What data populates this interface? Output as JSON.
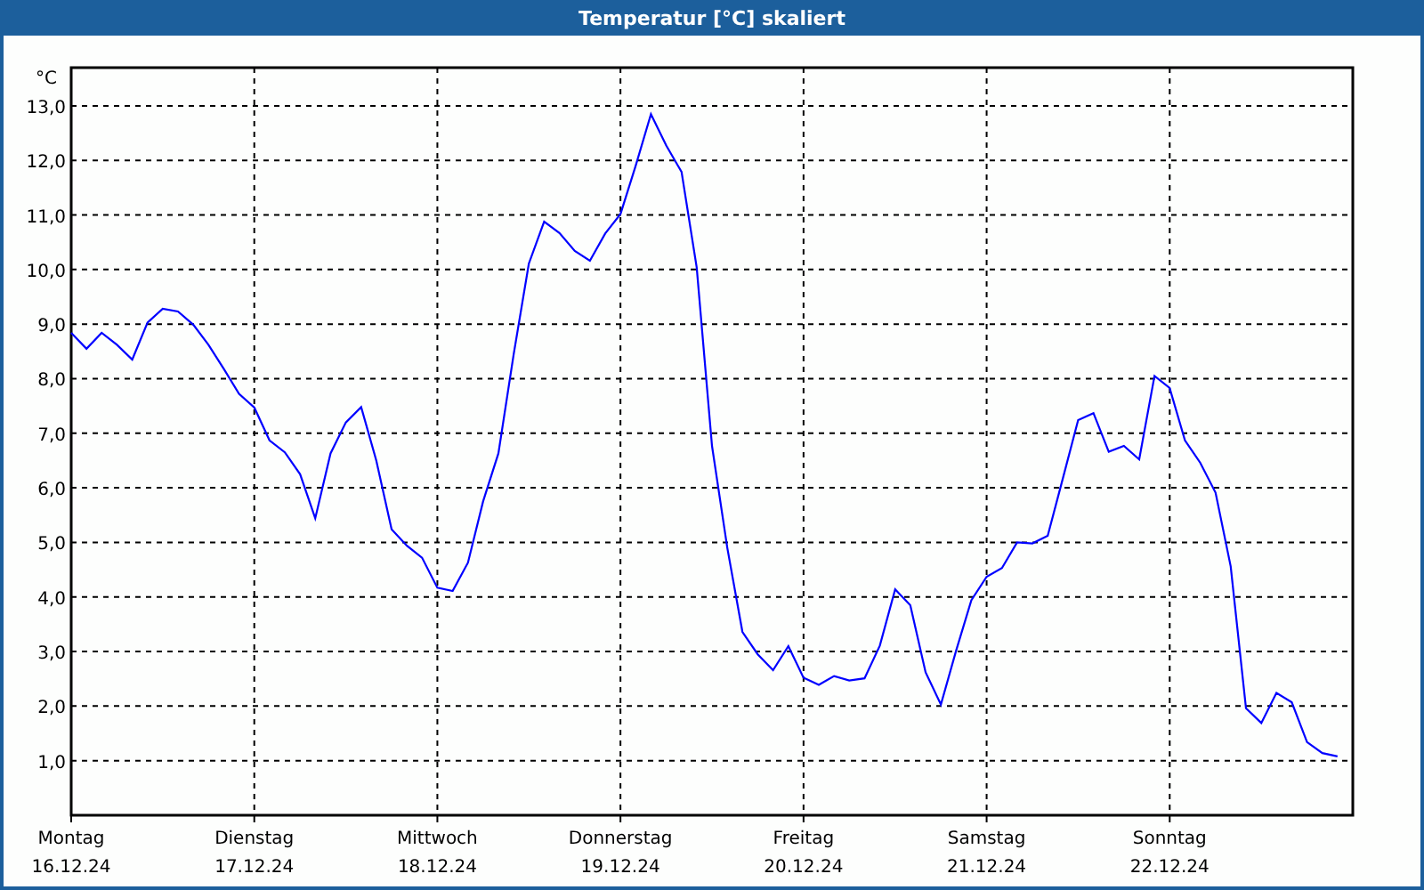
{
  "window": {
    "title": "Temperatur [°C] skaliert"
  },
  "chart": {
    "chart_data": {
      "type": "line",
      "ylabel": "°C",
      "grid": true,
      "ylim": [
        0,
        13.7
      ],
      "yticks": [
        {
          "value": 1,
          "label": "1,0"
        },
        {
          "value": 2,
          "label": "2,0"
        },
        {
          "value": 3,
          "label": "3,0"
        },
        {
          "value": 4,
          "label": "4,0"
        },
        {
          "value": 5,
          "label": "5,0"
        },
        {
          "value": 6,
          "label": "6,0"
        },
        {
          "value": 7,
          "label": "7,0"
        },
        {
          "value": 8,
          "label": "8,0"
        },
        {
          "value": 9,
          "label": "9,0"
        },
        {
          "value": 10,
          "label": "10,0"
        },
        {
          "value": 11,
          "label": "11,0"
        },
        {
          "value": 12,
          "label": "12,0"
        },
        {
          "value": 13,
          "label": "13,0"
        }
      ],
      "categories": [
        "Montag 16.12.24",
        null,
        null,
        null,
        null,
        null,
        null,
        null,
        null,
        null,
        null,
        null,
        "Dienstag 17.12.24",
        null,
        null,
        null,
        null,
        null,
        null,
        null,
        null,
        null,
        null,
        null,
        "Mittwoch 18.12.24",
        null,
        null,
        null,
        null,
        null,
        null,
        null,
        null,
        null,
        null,
        null,
        "Donnerstag 19.12.24",
        null,
        null,
        null,
        null,
        null,
        null,
        null,
        null,
        null,
        null,
        null,
        "Freitag 20.12.24",
        null,
        null,
        null,
        null,
        null,
        null,
        null,
        null,
        null,
        null,
        null,
        "Samstag 21.12.24",
        null,
        null,
        null,
        null,
        null,
        null,
        null,
        null,
        null,
        null,
        null,
        "Sonntag 22.12.24",
        null,
        null,
        null,
        null,
        null,
        null,
        null,
        null,
        null,
        null,
        null
      ],
      "series": [
        {
          "color": "#0000ff",
          "values": [
            8.84,
            8.55,
            8.84,
            8.62,
            8.35,
            9.03,
            9.28,
            9.23,
            8.99,
            8.62,
            8.18,
            7.72,
            7.47,
            6.87,
            6.65,
            6.25,
            5.44,
            6.63,
            7.2,
            7.48,
            6.5,
            5.24,
            4.94,
            4.72,
            4.17,
            4.11,
            4.63,
            5.75,
            6.63,
            8.45,
            10.11,
            10.88,
            10.67,
            10.34,
            10.16,
            10.66,
            11.02,
            11.9,
            12.85,
            12.27,
            11.79,
            10.04,
            6.77,
            4.9,
            3.36,
            2.95,
            2.66,
            3.1,
            2.52,
            2.39,
            2.55,
            2.47,
            2.51,
            3.11,
            4.14,
            3.85,
            2.62,
            2.03,
            3.01,
            3.94,
            4.37,
            4.53,
            5.0,
            4.98,
            5.12,
            6.17,
            7.24,
            7.37,
            6.66,
            6.77,
            6.52,
            8.05,
            7.83,
            6.87,
            6.46,
            5.91,
            4.56,
            1.96,
            1.69,
            2.24,
            2.07,
            1.34,
            1.14,
            1.08
          ]
        }
      ]
    }
  }
}
